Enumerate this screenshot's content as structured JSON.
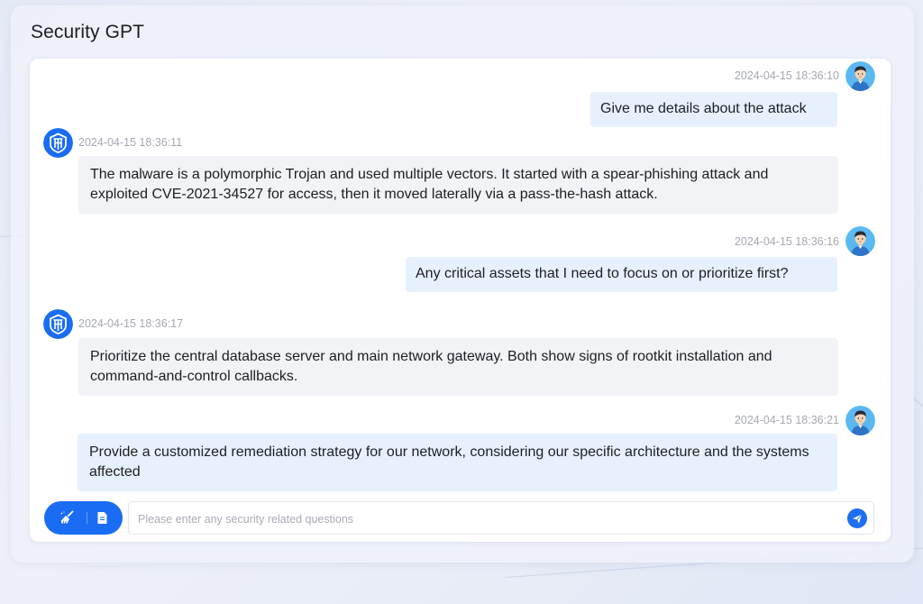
{
  "app": {
    "title": "Security GPT"
  },
  "messages": [
    {
      "role": "user",
      "timestamp": "2024-04-15 18:36:10",
      "text": "Give me details about the attack"
    },
    {
      "role": "bot",
      "timestamp": "2024-04-15 18:36:11",
      "text": "The malware is a polymorphic Trojan and used multiple vectors. It started with a spear-phishing attack and exploited CVE-2021-34527 for access, then it moved laterally via a pass-the-hash attack."
    },
    {
      "role": "user",
      "timestamp": "2024-04-15 18:36:16",
      "text": "Any critical assets that I need to focus on or prioritize first?"
    },
    {
      "role": "bot",
      "timestamp": "2024-04-15 18:36:17",
      "text": "Prioritize the central database server and main network gateway. Both show signs of rootkit installation and command-and-control callbacks."
    },
    {
      "role": "user",
      "timestamp": "2024-04-15 18:36:21",
      "text": "Provide a customized remediation strategy for our network, considering our specific architecture and the systems affected"
    }
  ],
  "input": {
    "placeholder": "Please enter any security related questions",
    "value": ""
  },
  "icons": {
    "user_avatar": "user-avatar-icon",
    "bot_avatar": "security-shield-logo-icon",
    "clear": "broom-icon",
    "document": "document-icon",
    "send": "paper-plane-icon"
  },
  "colors": {
    "accent": "#1a6df2",
    "user_bubble": "#e7f1fd",
    "bot_bubble": "#f2f3f7",
    "timestamp": "#a5a8b2",
    "avatar_bg": "#5ab9f2"
  }
}
